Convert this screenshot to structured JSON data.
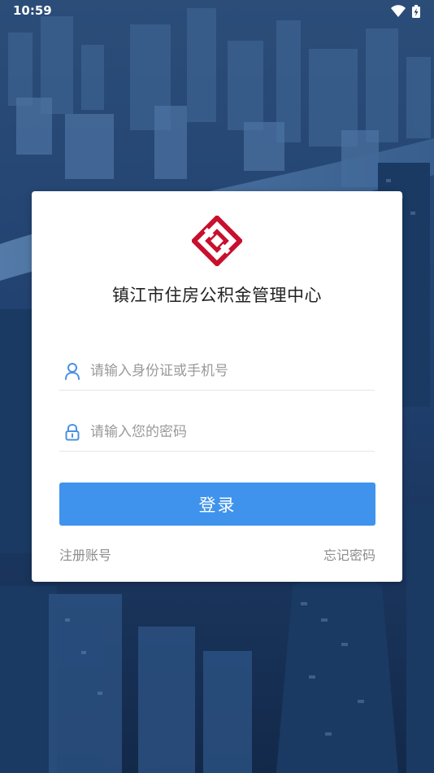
{
  "status_bar": {
    "time": "10:59",
    "icons": [
      "wifi-icon",
      "battery-charging-icon"
    ]
  },
  "login_card": {
    "logo_icon": "housing-fund-logo",
    "org_name": "镇江市住房公积金管理中心",
    "username": {
      "icon": "user-icon",
      "placeholder": "请输入身份证或手机号",
      "value": ""
    },
    "password": {
      "icon": "lock-icon",
      "placeholder": "请输入您的密码",
      "value": ""
    },
    "login_label": "登录",
    "register_label": "注册账号",
    "forgot_label": "忘记密码"
  },
  "colors": {
    "background": "#1f3f66",
    "accent": "#3f93ec",
    "logo": "#c8102e",
    "icon": "#4a90e2"
  }
}
